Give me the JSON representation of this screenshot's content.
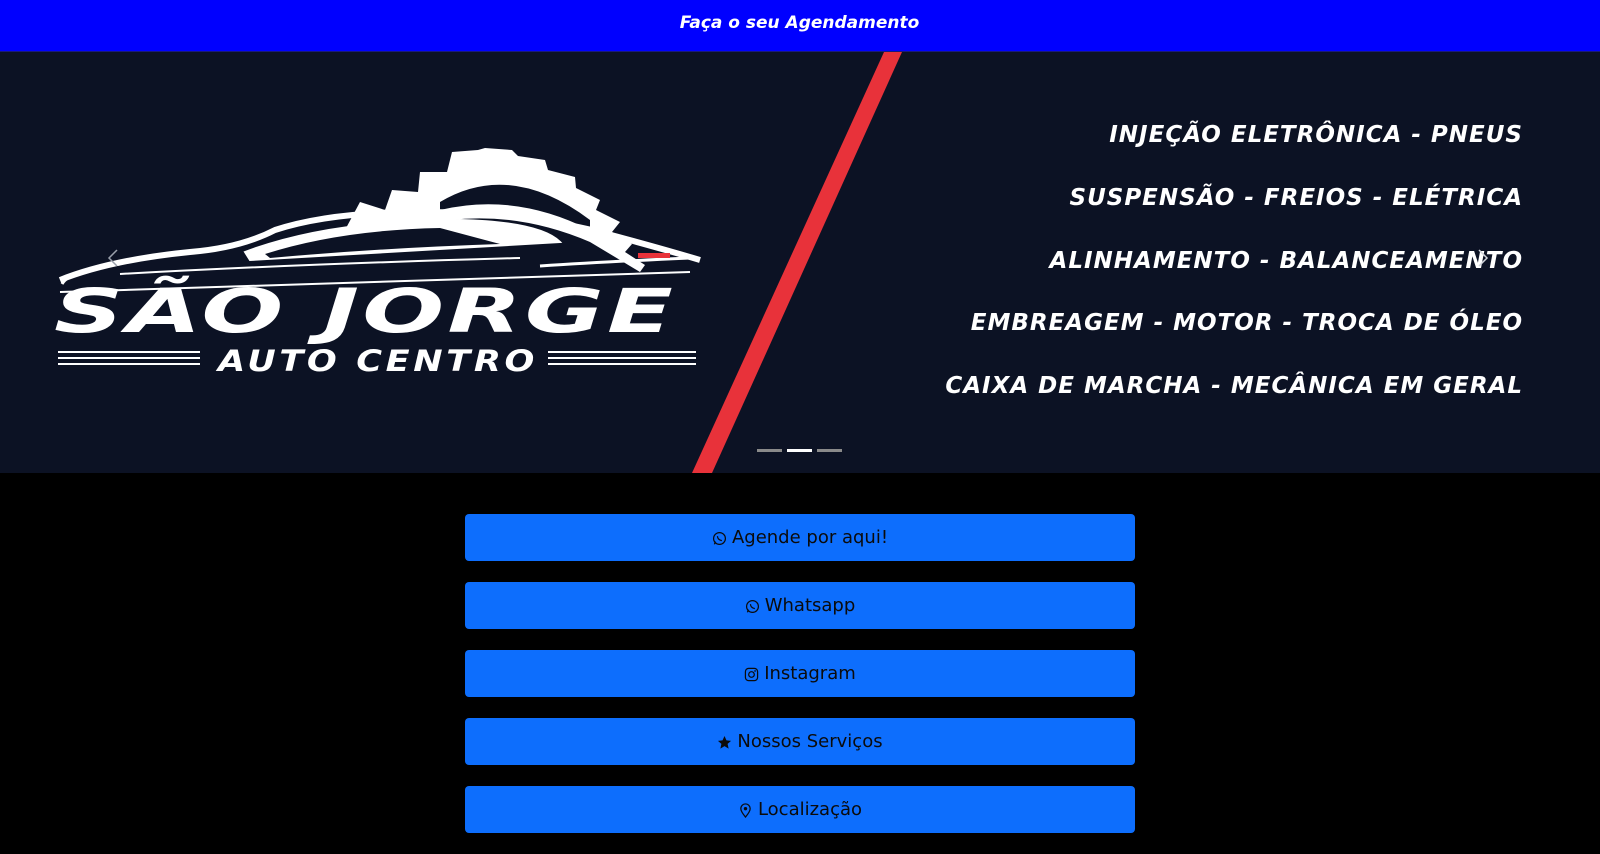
{
  "topbar": {
    "title": "Faça o seu Agendamento",
    "bg_color": "#0000ff"
  },
  "banner": {
    "logo": {
      "title": "SÃO JORGE",
      "subtitle": "AUTO CENTRO"
    },
    "services": [
      "INJEÇÃO ELETRÔNICA - PNEUS",
      "SUSPENSÃO - FREIOS - ELÉTRICA",
      "ALINHAMENTO - BALANCEAMENTO",
      "EMBREAGEM - MOTOR - TROCA DE ÓLEO",
      "CAIXA DE MARCHA - MECÂNICA EM GERAL"
    ],
    "active_slide": 2,
    "slide_count": 3,
    "accent_color": "#e8323a",
    "bg_color": "#0c1224"
  },
  "links": [
    {
      "label": "Agende por aqui!",
      "icon": "whatsapp-icon"
    },
    {
      "label": "Whatsapp",
      "icon": "whatsapp-icon"
    },
    {
      "label": "Instagram",
      "icon": "instagram-icon"
    },
    {
      "label": "Nossos Serviços",
      "icon": "star-icon"
    },
    {
      "label": "Localização",
      "icon": "location-pin-icon"
    }
  ],
  "button_color": "#0d6efd"
}
